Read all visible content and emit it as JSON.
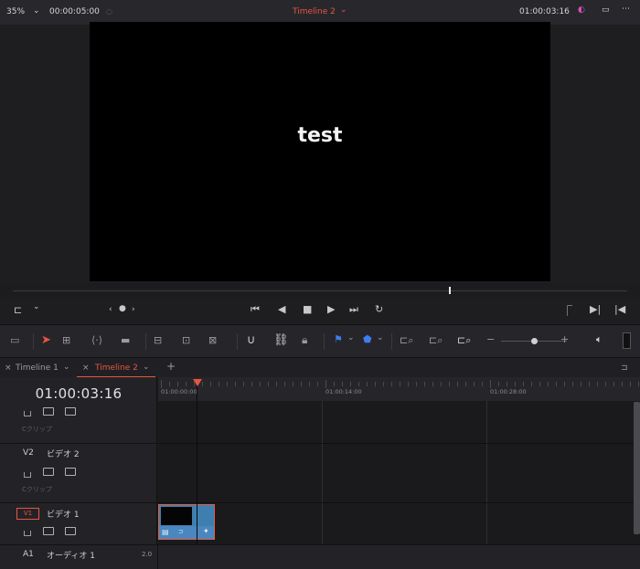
{
  "topbar": {
    "zoom": "35%",
    "source_timecode": "00:00:05:00",
    "timeline_name": "Timeline 2",
    "record_timecode": "01:00:03:16"
  },
  "viewer": {
    "text": "test"
  },
  "timeline_tabs": [
    {
      "label": "Timeline 1"
    },
    {
      "label": "Timeline 2"
    }
  ],
  "timeline": {
    "timecode": "01:00:03:16",
    "ruler_labels": [
      "01:00:00:00",
      "01:00:14:00",
      "01:00:28:00"
    ]
  },
  "tracks": {
    "v3_clip_label": "Cクリップ",
    "v2_id": "V2",
    "v2_name": "ビデオ 2",
    "v2_clip_label": "Cクリップ",
    "v1_id": "V1",
    "v1_name": "ビデオ 1",
    "a1_id": "A1",
    "a1_name": "オーディオ 1",
    "a1_channels": "2.0"
  },
  "colors": {
    "accent": "#e8553f",
    "clip_blue": "#3f7fb0",
    "flag_blue": "#3d7ff2"
  }
}
